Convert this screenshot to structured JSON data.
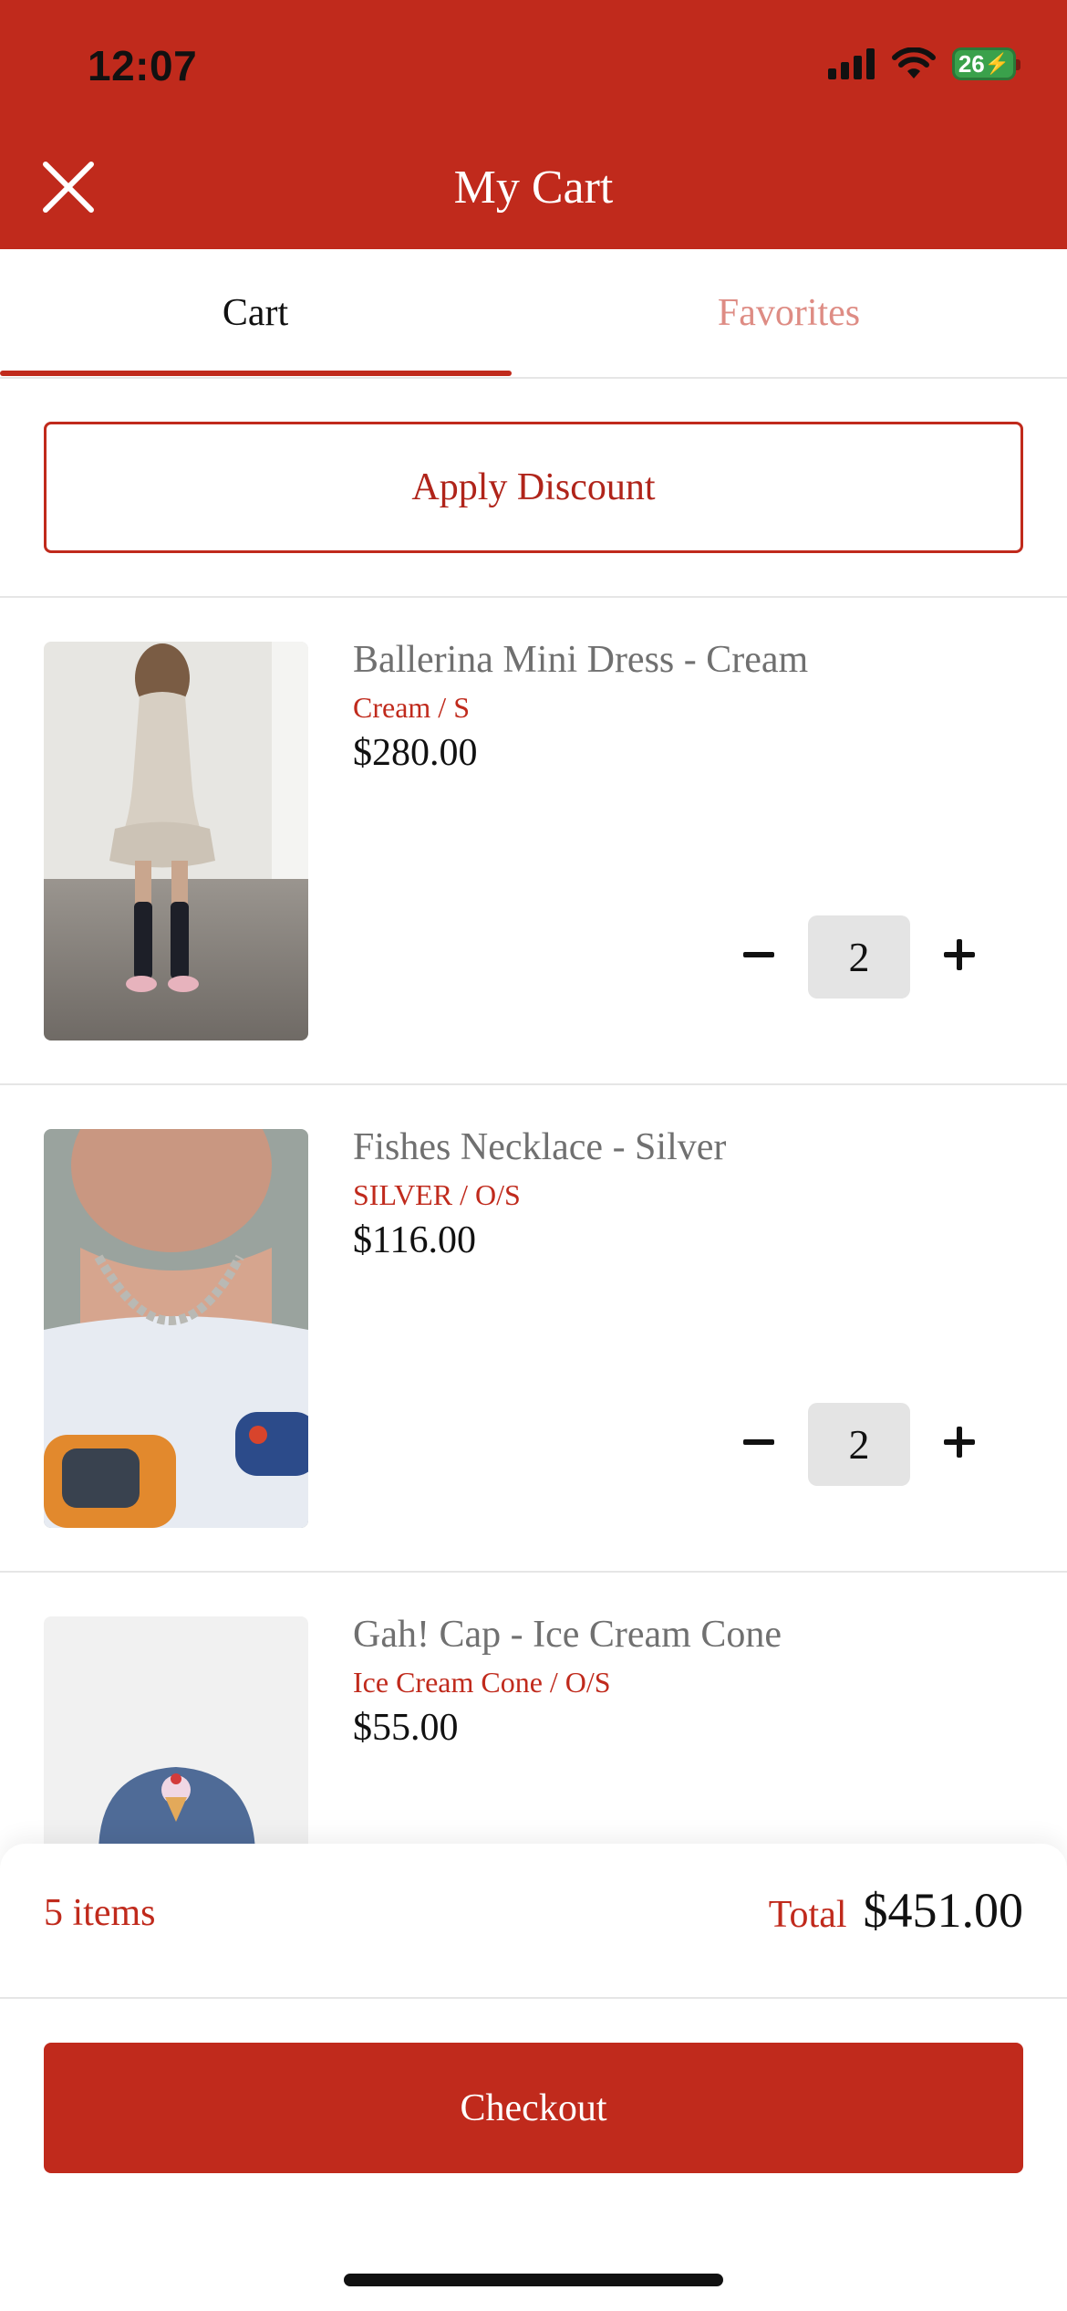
{
  "status_bar": {
    "time": "12:07",
    "battery": "26"
  },
  "header": {
    "title": "My Cart",
    "close_icon": "close-icon"
  },
  "tabs": [
    {
      "label": "Cart",
      "active": true
    },
    {
      "label": "Favorites",
      "active": false
    }
  ],
  "discount": {
    "label": "Apply Discount"
  },
  "items": [
    {
      "name": "Ballerina Mini Dress - Cream",
      "variant": "Cream / S",
      "price": "$280.00",
      "quantity": "2"
    },
    {
      "name": "Fishes Necklace - Silver",
      "variant": "SILVER / O/S",
      "price": "$116.00",
      "quantity": "2"
    },
    {
      "name": "Gah! Cap - Ice Cream Cone",
      "variant": "Ice Cream Cone / O/S",
      "price": "$55.00"
    }
  ],
  "summary": {
    "items_count": "5 items",
    "total_label": "Total",
    "total_value": "$451.00"
  },
  "checkout": {
    "label": "Checkout"
  },
  "colors": {
    "brand": "#c02a1c",
    "tab_inactive": "#de8c84",
    "qty_box": "#e4e4e4"
  }
}
